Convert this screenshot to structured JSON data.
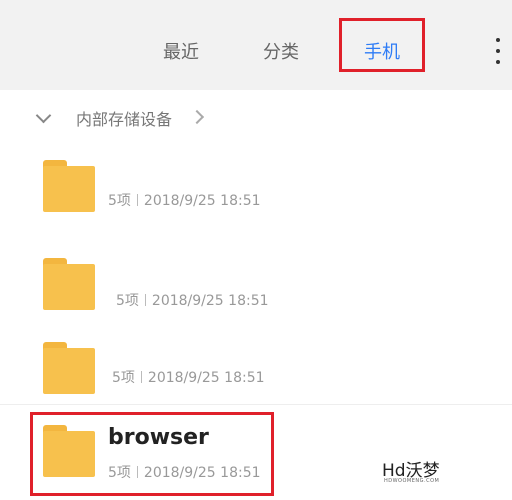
{
  "tabs": [
    {
      "label": "最近",
      "active": false
    },
    {
      "label": "分类",
      "active": false
    },
    {
      "label": "手机",
      "active": true
    }
  ],
  "path": {
    "label": "内部存储设备"
  },
  "folders": [
    {
      "name": "",
      "count": "5项",
      "date": "2018/9/25 18:51"
    },
    {
      "name": "",
      "count": "5项",
      "date": "2018/9/25 18:51"
    },
    {
      "name": "",
      "count": "5项",
      "date": "2018/9/25 18:51"
    },
    {
      "name": "browser",
      "count": "5项",
      "date": "2018/9/25 18:51"
    }
  ],
  "watermark": {
    "text": "Hd沃梦",
    "sub": "HDWOOMENG.COM"
  },
  "colors": {
    "accent": "#2e7cf6",
    "highlight": "#e0202a",
    "folder": "#f7c14d",
    "header_bg": "#f2f2f2"
  }
}
